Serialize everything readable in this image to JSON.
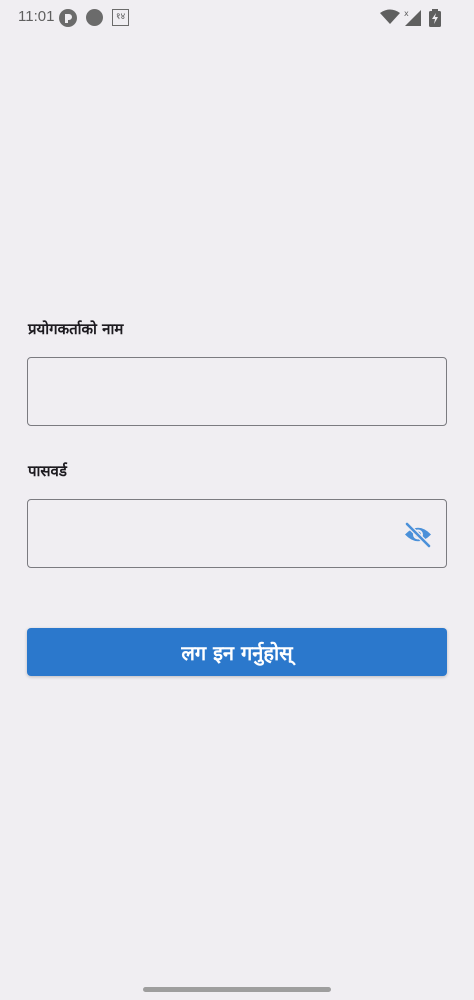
{
  "status_bar": {
    "time": "11:01",
    "nepali_badge": "१४",
    "icons": [
      "app-r-icon",
      "circle-icon",
      "nepali-number-icon",
      "wifi-icon",
      "signal-icon",
      "battery-charging-icon"
    ]
  },
  "login_form": {
    "username_label": "प्रयोगकर्ताको नाम",
    "username_value": "",
    "password_label": "पासवर्ड",
    "password_value": "",
    "password_visibility_icon": "eye-off-icon",
    "submit_label": "लग इन गर्नुहोस्"
  },
  "colors": {
    "background": "#f0eef2",
    "primary": "#2b78cc",
    "icon_accent": "#4a90d9"
  }
}
